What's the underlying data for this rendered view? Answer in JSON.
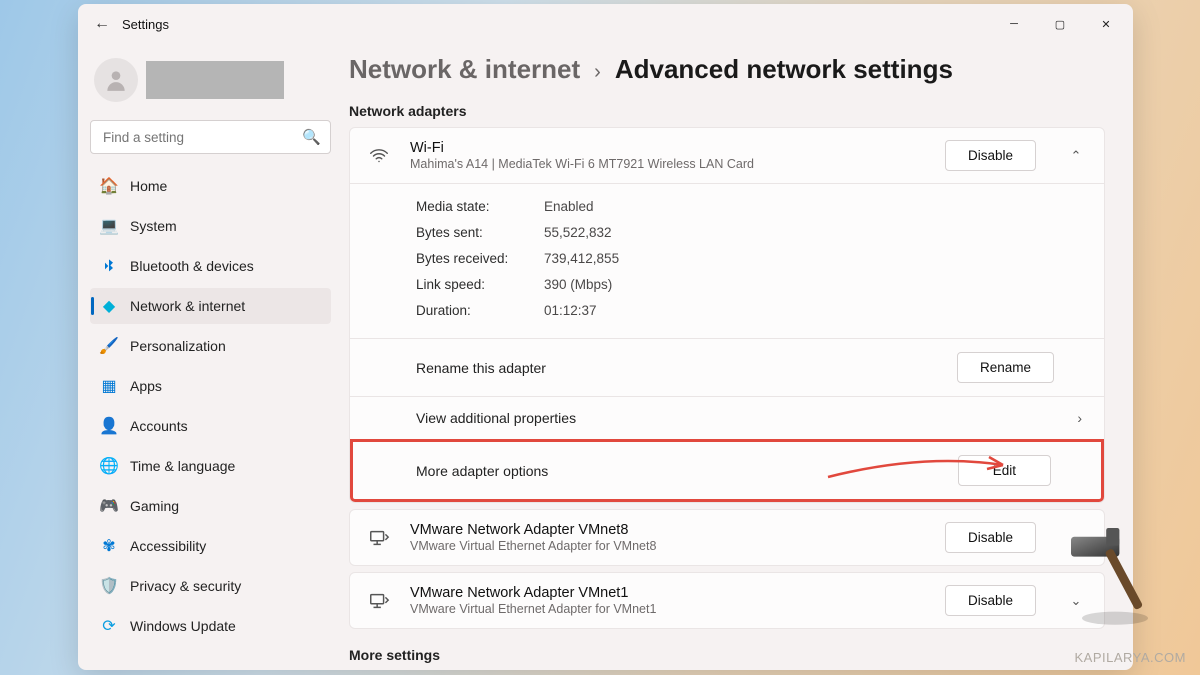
{
  "app_title": "Settings",
  "search": {
    "placeholder": "Find a setting"
  },
  "nav": [
    {
      "icon": "🏠",
      "label": "Home"
    },
    {
      "icon": "💻",
      "label": "System"
    },
    {
      "icon": "bt",
      "label": "Bluetooth & devices"
    },
    {
      "icon": "💎",
      "label": "Network & internet",
      "active": true
    },
    {
      "icon": "🖌️",
      "label": "Personalization"
    },
    {
      "icon": "📦",
      "label": "Apps"
    },
    {
      "icon": "👤",
      "label": "Accounts"
    },
    {
      "icon": "🌐",
      "label": "Time & language"
    },
    {
      "icon": "🎮",
      "label": "Gaming"
    },
    {
      "icon": "♿",
      "label": "Accessibility"
    },
    {
      "icon": "🛡️",
      "label": "Privacy & security"
    },
    {
      "icon": "🔄",
      "label": "Windows Update"
    }
  ],
  "breadcrumb": {
    "parent": "Network & internet",
    "current": "Advanced network settings"
  },
  "section_adapters": "Network adapters",
  "wifi": {
    "title": "Wi-Fi",
    "sub": "Mahima's A14 | MediaTek Wi-Fi 6 MT7921 Wireless LAN Card",
    "disable": "Disable",
    "details": [
      {
        "k": "Media state:",
        "v": "Enabled"
      },
      {
        "k": "Bytes sent:",
        "v": "55,522,832"
      },
      {
        "k": "Bytes received:",
        "v": "739,412,855"
      },
      {
        "k": "Link speed:",
        "v": "390 (Mbps)"
      },
      {
        "k": "Duration:",
        "v": "01:12:37"
      }
    ],
    "rename_label": "Rename this adapter",
    "rename_btn": "Rename",
    "view_props": "View additional properties",
    "more_opts": "More adapter options",
    "edit_btn": "Edit"
  },
  "vmnet8": {
    "title": "VMware Network Adapter VMnet8",
    "sub": "VMware Virtual Ethernet Adapter for VMnet8",
    "btn": "Disable"
  },
  "vmnet1": {
    "title": "VMware Network Adapter VMnet1",
    "sub": "VMware Virtual Ethernet Adapter for VMnet1",
    "btn": "Disable"
  },
  "section_more": "More settings",
  "watermark": "KAPILARYA.COM"
}
